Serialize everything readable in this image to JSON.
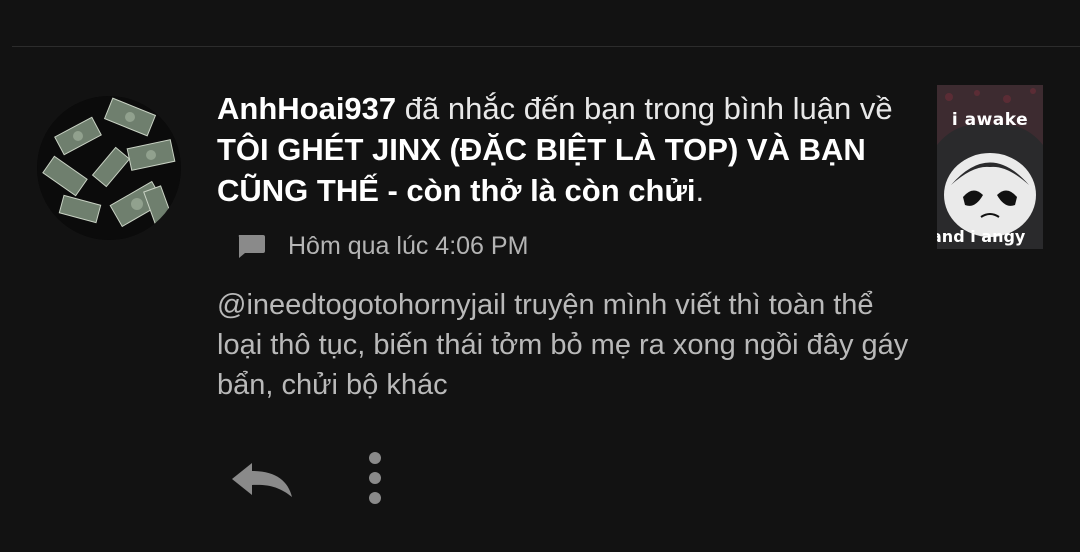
{
  "notification": {
    "username": "AnhHoai937",
    "mention_text": " đã nhắc đến bạn trong bình luận về ",
    "story_title": "TÔI GHÉT JINX (ĐẶC BIỆT LÀ TOP) VÀ BẠN CŨNG THẾ - còn thở là còn chửi",
    "end_punct": ".",
    "timestamp": "Hôm qua lúc 4:06 PM",
    "comment": "@ineedtogotohornyjail truyện mình viết thì toàn thể loại thô tục, biến thái tởm bỏ mẹ ra xong ngồi đây gáy bẩn, chửi bộ khác"
  },
  "thumbnail": {
    "top_text": "i awake",
    "bottom_text": "and i angy"
  },
  "icons": {
    "avatar": "money-avatar",
    "comment": "comment-icon",
    "reply": "reply-icon",
    "more": "more-vertical-icon"
  },
  "colors": {
    "background": "#121212",
    "text_primary": "#f1f1f1",
    "text_secondary": "#b4b4b4",
    "icon": "#8a8a8a"
  }
}
